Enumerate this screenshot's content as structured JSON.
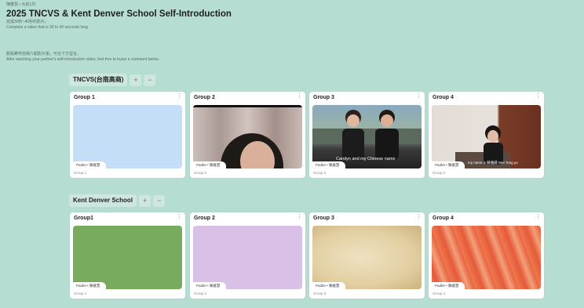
{
  "header": {
    "breadcrumb": "陳雅慧 • 大約1月",
    "title": "2025 TNCVS & Kent Denver School Self-Introduction",
    "subtitle_zh": "完成30秒~40秒的影片。",
    "subtitle_en": "Complete a video that is 30 to 40 seconds long.",
    "desc_zh": "觀看夥伴自我介紹影片後，可在下方留言。",
    "desc_en": "After watching your partner's self-introduction video, feel free to leave a comment below."
  },
  "sections": [
    {
      "title": "TNCVS(台南高商)",
      "add_icon": "+",
      "collapse_icon": "−",
      "cards": [
        {
          "title": "Group 1",
          "author": "Padlet • 陳雅慧",
          "footer": "Group 1",
          "color": "#c3def6"
        },
        {
          "title": "Group 2",
          "author": "Padlet • 陳雅慧",
          "footer": "Group 2"
        },
        {
          "title": "Group 3",
          "author": "Padlet • 陳雅慧",
          "footer": "Group 3",
          "caption": "Carolyn and my Chinese name"
        },
        {
          "title": "Group 4",
          "author": "Padlet • 陳雅慧",
          "footer": "Group 4",
          "caption": "my name is 蘇雅葳 Wei Tong yu"
        }
      ]
    },
    {
      "title": "Kent Denver School",
      "add_icon": "+",
      "collapse_icon": "−",
      "cards": [
        {
          "title": "Group1",
          "author": "Padlet • 陳雅慧",
          "footer": "Group 1",
          "color": "#79ab5f"
        },
        {
          "title": "Group 2",
          "author": "Padlet • 陳雅慧",
          "footer": "Group 2",
          "color": "#d9c0e6"
        },
        {
          "title": "Group 3",
          "author": "Padlet • 陳雅慧",
          "footer": "Group 3"
        },
        {
          "title": "Group 4",
          "author": "Padlet • 陳雅慧",
          "footer": "Group 4"
        }
      ]
    }
  ],
  "kebab_icon": "⋮",
  "colors": {
    "background": "#b6ddd2",
    "card": "#ffffff",
    "section_chip": "#cfe6df"
  }
}
